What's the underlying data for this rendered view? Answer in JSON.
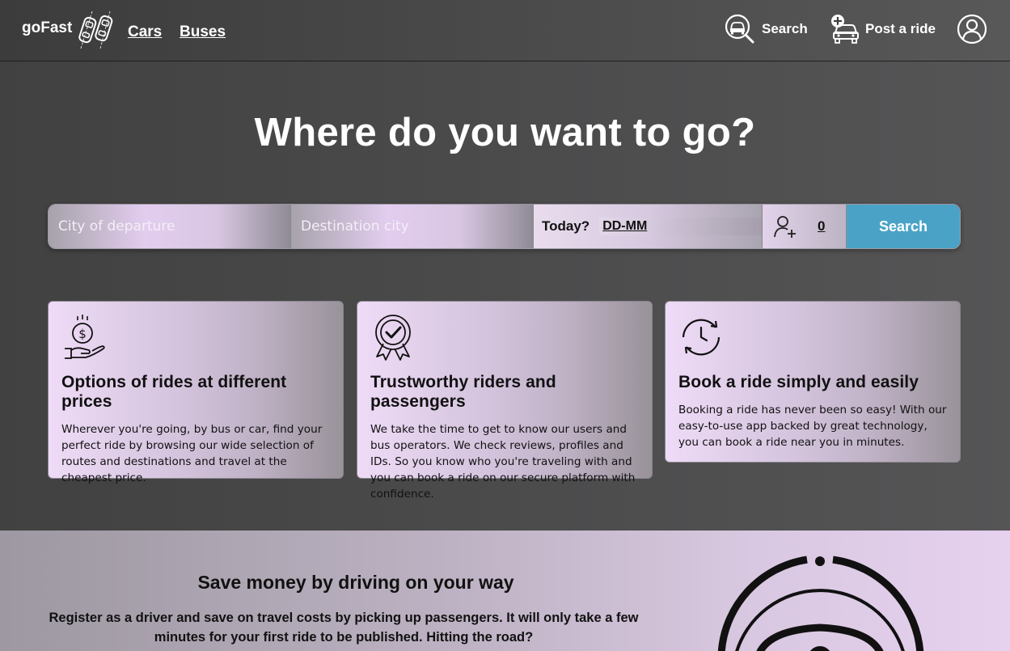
{
  "header": {
    "logo_text": "goFast",
    "nav": [
      {
        "label": "Cars"
      },
      {
        "label": "Buses"
      }
    ],
    "search_label": "Search",
    "post_ride_label": "Post a ride"
  },
  "hero": {
    "title": "Where do you want to go?"
  },
  "search_form": {
    "departure_placeholder": "City of departure",
    "destination_placeholder": "Destination city",
    "date_label": "Today?",
    "date_value": "DD-MM",
    "passengers_count": "0",
    "search_button": "Search"
  },
  "features": [
    {
      "icon": "money-hand-icon",
      "title": "Options of rides at different prices",
      "text": "Wherever you're going, by bus or car, find your perfect ride by browsing our wide selection of routes and destinations and travel at the cheapest price."
    },
    {
      "icon": "verified-badge-icon",
      "title": "Trustworthy riders and passengers",
      "text": "We take the time to get to know our users and bus operators. We check reviews, profiles and IDs. So you know who you're traveling with and you can book a ride on our secure platform with confidence."
    },
    {
      "icon": "clock-refresh-icon",
      "title": "Book a ride simply and easily",
      "text": "Booking a ride has never been so easy! With our easy-to-use app backed by great technology, you can book a ride near you in minutes."
    }
  ],
  "promo": {
    "title": "Save money by driving on your way",
    "text": "Register as a driver and save on travel costs by picking up passengers. It will only take a few minutes for your first ride to be published. Hitting the road?"
  },
  "colors": {
    "accent": "#4aa3c7",
    "header_bg": "#444444",
    "hero_bg": "#4a4a4a",
    "card_gradient_start": "#efdbf7"
  }
}
